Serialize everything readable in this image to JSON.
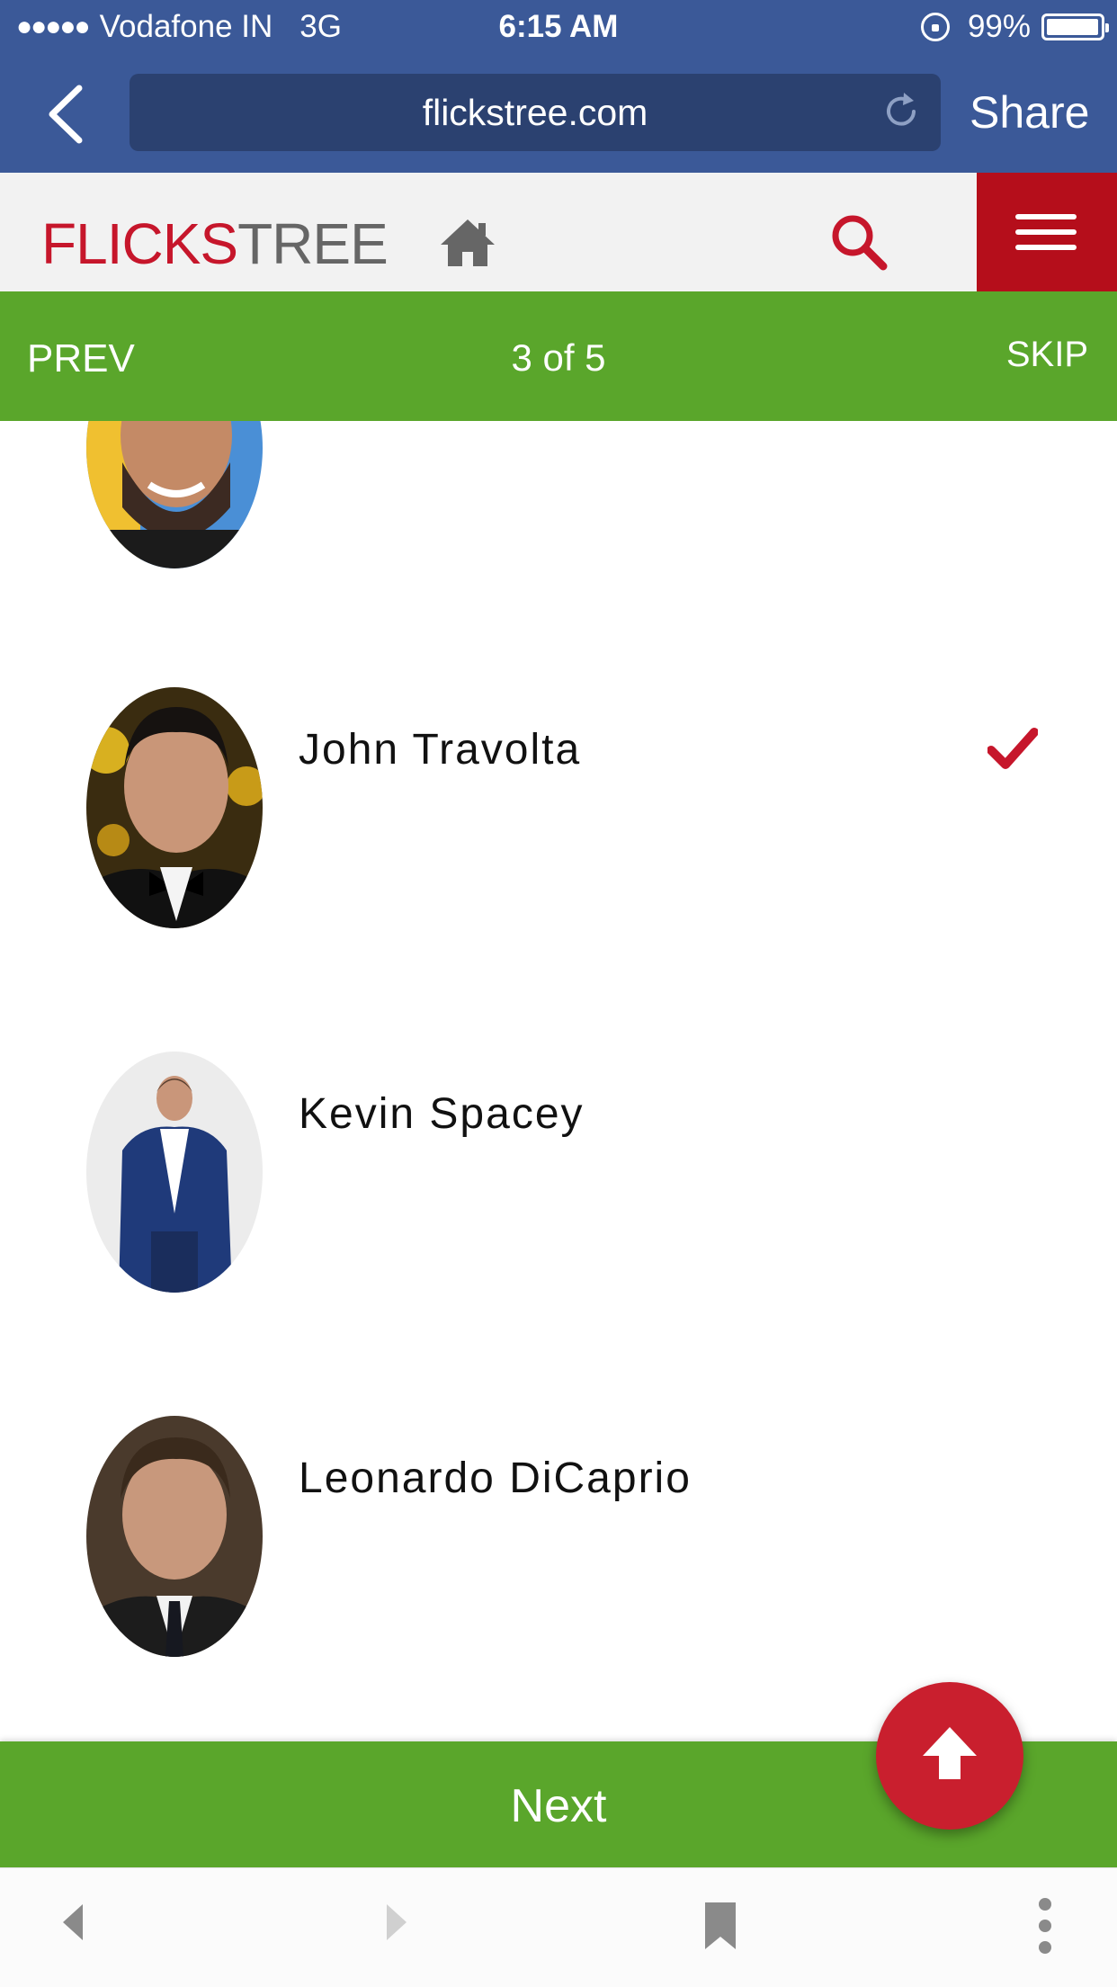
{
  "status_bar": {
    "carrier": "Vodafone IN",
    "network": "3G",
    "time": "6:15 AM",
    "battery": "99%",
    "battery_level": 0.99
  },
  "browser": {
    "url": "flickstree.com",
    "share_label": "Share"
  },
  "site": {
    "logo_part1": "FLICKS",
    "logo_part2": "TREE",
    "brand_color": "#c6162b"
  },
  "pager": {
    "prev_label": "PREV",
    "position": "3 of 5",
    "skip_label": "SKIP"
  },
  "actors": [
    {
      "name": "",
      "selected": false
    },
    {
      "name": "John Travolta",
      "selected": true
    },
    {
      "name": "Kevin Spacey",
      "selected": false
    },
    {
      "name": "Leonardo DiCaprio",
      "selected": false
    }
  ],
  "footer": {
    "next_label": "Next",
    "accent_green": "#5aa62b",
    "fab_color": "#c91f2e"
  }
}
